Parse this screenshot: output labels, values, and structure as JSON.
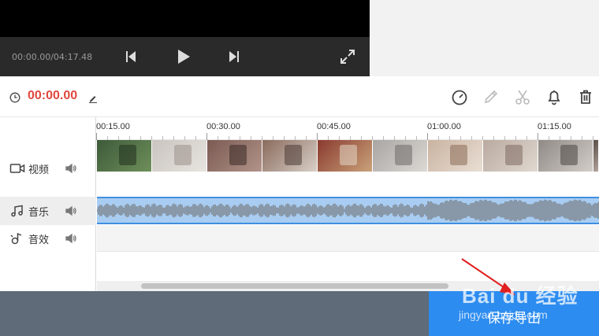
{
  "player": {
    "time_readout": "00:00.00/04:17.48",
    "icons": [
      "previous-icon",
      "play-icon",
      "next-icon",
      "fullscreen-icon"
    ]
  },
  "editor": {
    "current_time": "00:00.00",
    "tools": [
      "speed-icon",
      "pencil-icon",
      "scissors-icon",
      "bell-icon",
      "trash-icon"
    ]
  },
  "ruler": {
    "ticks": [
      "00:15.00",
      "00:30.00",
      "00:45.00",
      "01:00.00",
      "01:15.00"
    ]
  },
  "tracks": {
    "video": {
      "label": "视频"
    },
    "music": {
      "label": "音乐"
    },
    "sfx": {
      "label": "音效"
    }
  },
  "footer": {
    "save_label": "保存导出"
  },
  "watermark": {
    "brand": "Bai du 经验",
    "url": "jingyan.baidu.com"
  },
  "colors": {
    "accent": "#2c8cf0",
    "time_red": "#e0483e",
    "music_clip": "#a9cdf2"
  }
}
